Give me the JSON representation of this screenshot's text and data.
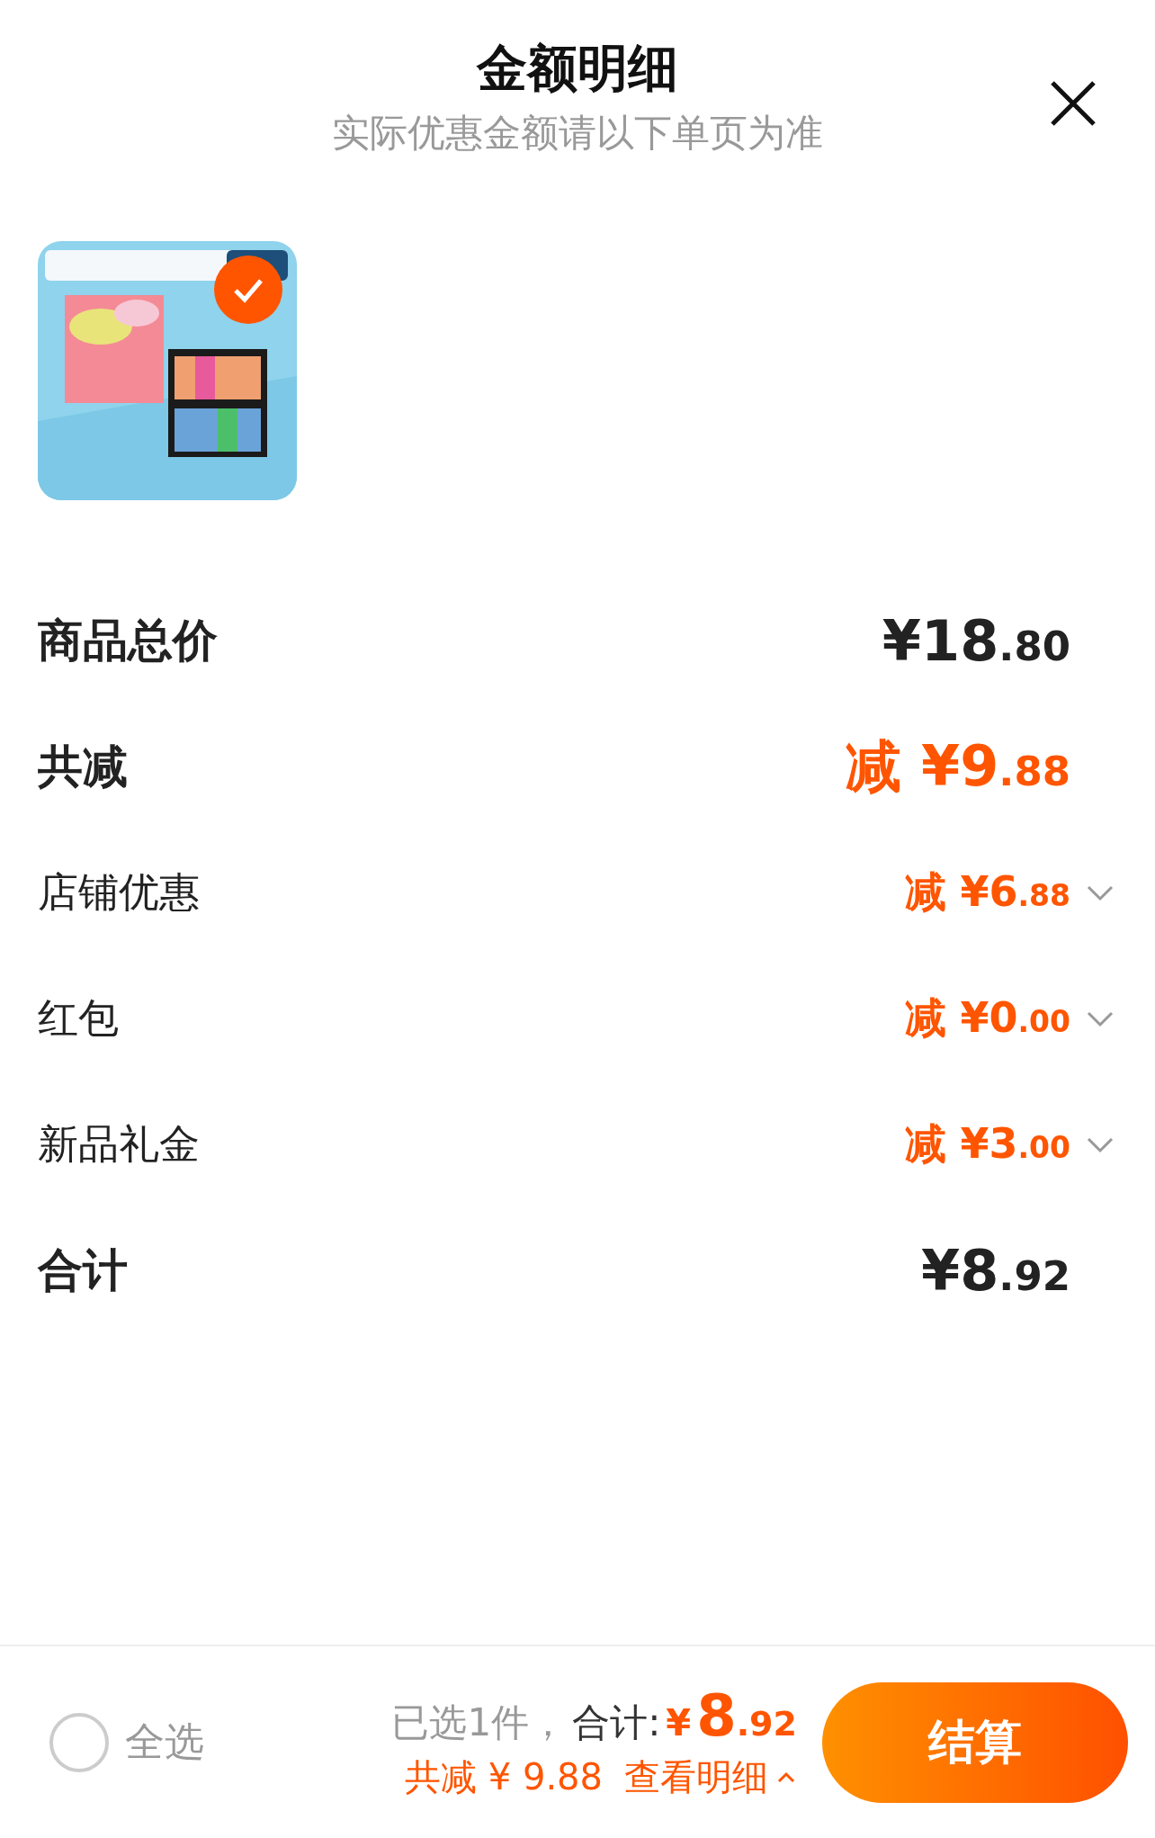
{
  "header": {
    "title": "金额明细",
    "subtitle": "实际优惠金额请以下单页为准"
  },
  "product": {
    "kind": "picture",
    "selected": true
  },
  "rows": [
    {
      "kind": "heading",
      "label": "商品总价",
      "value": "¥18.80"
    },
    {
      "kind": "saving",
      "label": "共减",
      "value": "减 ¥9.88"
    },
    {
      "kind": "discount",
      "label": "店铺优惠",
      "value": "减 ¥6.88",
      "expanded": false
    },
    {
      "kind": "discount",
      "label": "红包",
      "value": "减 ¥0.00",
      "expanded": false
    },
    {
      "kind": "discount",
      "label": "新品礼金",
      "value": "减 ¥3.00",
      "expanded": false
    },
    {
      "kind": "heading",
      "label": "合计",
      "value": "¥8.92"
    }
  ],
  "bottom_bar": {
    "select_all": {
      "label": "全选",
      "checked": false
    },
    "summary": {
      "count": "已选1件，",
      "label": "合计:",
      "currency": "¥",
      "amount": "8.92"
    },
    "savings": {
      "text": "共减 ¥ 9.88",
      "link": "查看明细",
      "expanded": false
    },
    "checkout": "结算"
  }
}
